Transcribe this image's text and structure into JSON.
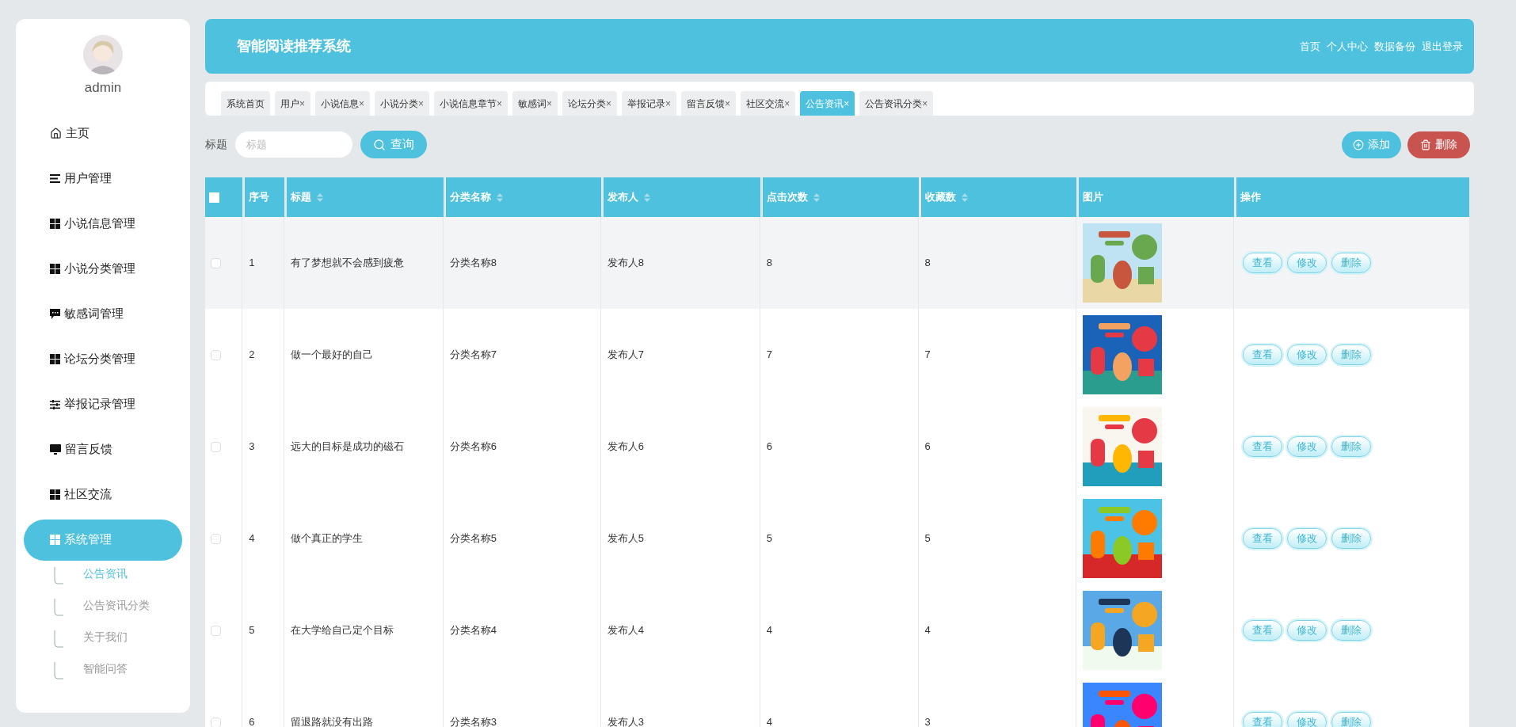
{
  "sidebar": {
    "username": "admin",
    "items": [
      {
        "label": "主页",
        "kind": "home",
        "selected": false
      },
      {
        "label": "用户管理",
        "kind": "lines",
        "selected": false
      },
      {
        "label": "小说信息管理",
        "kind": "grid",
        "selected": false
      },
      {
        "label": "小说分类管理",
        "kind": "grid",
        "selected": false
      },
      {
        "label": "敏感词管理",
        "kind": "chat",
        "selected": false
      },
      {
        "label": "论坛分类管理",
        "kind": "grid",
        "selected": false
      },
      {
        "label": "举报记录管理",
        "kind": "sliders",
        "selected": false
      },
      {
        "label": "留言反馈",
        "kind": "monitor",
        "selected": false
      },
      {
        "label": "社区交流",
        "kind": "grid",
        "selected": false
      },
      {
        "label": "系统管理",
        "kind": "grid",
        "selected": true,
        "children": [
          {
            "label": "公告资讯",
            "selected": true
          },
          {
            "label": "公告资讯分类",
            "selected": false
          },
          {
            "label": "关于我们",
            "selected": false
          },
          {
            "label": "智能问答",
            "selected": false
          }
        ]
      }
    ]
  },
  "header": {
    "title": "智能阅读推荐系统",
    "links": [
      "首页",
      "个人中心",
      "数据备份",
      "退出登录"
    ]
  },
  "tabs": [
    {
      "label": "系统首页",
      "closable": false,
      "selected": false
    },
    {
      "label": "用户",
      "closable": true,
      "selected": false
    },
    {
      "label": "小说信息",
      "closable": true,
      "selected": false
    },
    {
      "label": "小说分类",
      "closable": true,
      "selected": false
    },
    {
      "label": "小说信息章节",
      "closable": true,
      "selected": false
    },
    {
      "label": "敏感词",
      "closable": true,
      "selected": false
    },
    {
      "label": "论坛分类",
      "closable": true,
      "selected": false
    },
    {
      "label": "举报记录",
      "closable": true,
      "selected": false
    },
    {
      "label": "留言反馈",
      "closable": true,
      "selected": false
    },
    {
      "label": "社区交流",
      "closable": true,
      "selected": false
    },
    {
      "label": "公告资讯",
      "closable": true,
      "selected": true
    },
    {
      "label": "公告资讯分类",
      "closable": true,
      "selected": false
    }
  ],
  "close_mark": "×",
  "search": {
    "label": "标题",
    "placeholder": "标题",
    "button": "查询"
  },
  "actions": {
    "add": "添加",
    "delete": "删除"
  },
  "table": {
    "columns": [
      {
        "label": "序号",
        "sortable": false
      },
      {
        "label": "标题",
        "sortable": true
      },
      {
        "label": "分类名称",
        "sortable": true
      },
      {
        "label": "发布人",
        "sortable": true
      },
      {
        "label": "点击次数",
        "sortable": true
      },
      {
        "label": "收藏数",
        "sortable": true
      },
      {
        "label": "图片",
        "sortable": false
      },
      {
        "label": "操作",
        "sortable": false
      }
    ],
    "header_checked": false,
    "rows": [
      {
        "checked": false,
        "hovered": true,
        "cells": [
          "1",
          "有了梦想就不会感到疲惫",
          "分类名称8",
          "发布人8",
          "8",
          "8"
        ],
        "picture": {
          "kind": "picture"
        },
        "buttons": [
          "查看",
          "修改",
          "删除"
        ]
      },
      {
        "checked": false,
        "hovered": false,
        "cells": [
          "2",
          "做一个最好的自己",
          "分类名称7",
          "发布人7",
          "7",
          "7"
        ],
        "picture": {
          "kind": "picture"
        },
        "buttons": [
          "查看",
          "修改",
          "删除"
        ]
      },
      {
        "checked": false,
        "hovered": false,
        "cells": [
          "3",
          "远大的目标是成功的磁石",
          "分类名称6",
          "发布人6",
          "6",
          "6"
        ],
        "picture": {
          "kind": "picture"
        },
        "buttons": [
          "查看",
          "修改",
          "删除"
        ]
      },
      {
        "checked": false,
        "hovered": false,
        "cells": [
          "4",
          "做个真正的学生",
          "分类名称5",
          "发布人5",
          "5",
          "5"
        ],
        "picture": {
          "kind": "picture"
        },
        "buttons": [
          "查看",
          "修改",
          "删除"
        ]
      },
      {
        "checked": false,
        "hovered": false,
        "cells": [
          "5",
          "在大学给自己定个目标",
          "分类名称4",
          "发布人4",
          "4",
          "4"
        ],
        "picture": {
          "kind": "picture"
        },
        "buttons": [
          "查看",
          "修改",
          "删除"
        ]
      },
      {
        "checked": false,
        "hovered": false,
        "cells": [
          "6",
          "留退路就没有出路",
          "分类名称3",
          "发布人3",
          "4",
          "3"
        ],
        "picture": {
          "kind": "picture"
        },
        "buttons": [
          "查看",
          "修改",
          "删除"
        ]
      }
    ]
  }
}
